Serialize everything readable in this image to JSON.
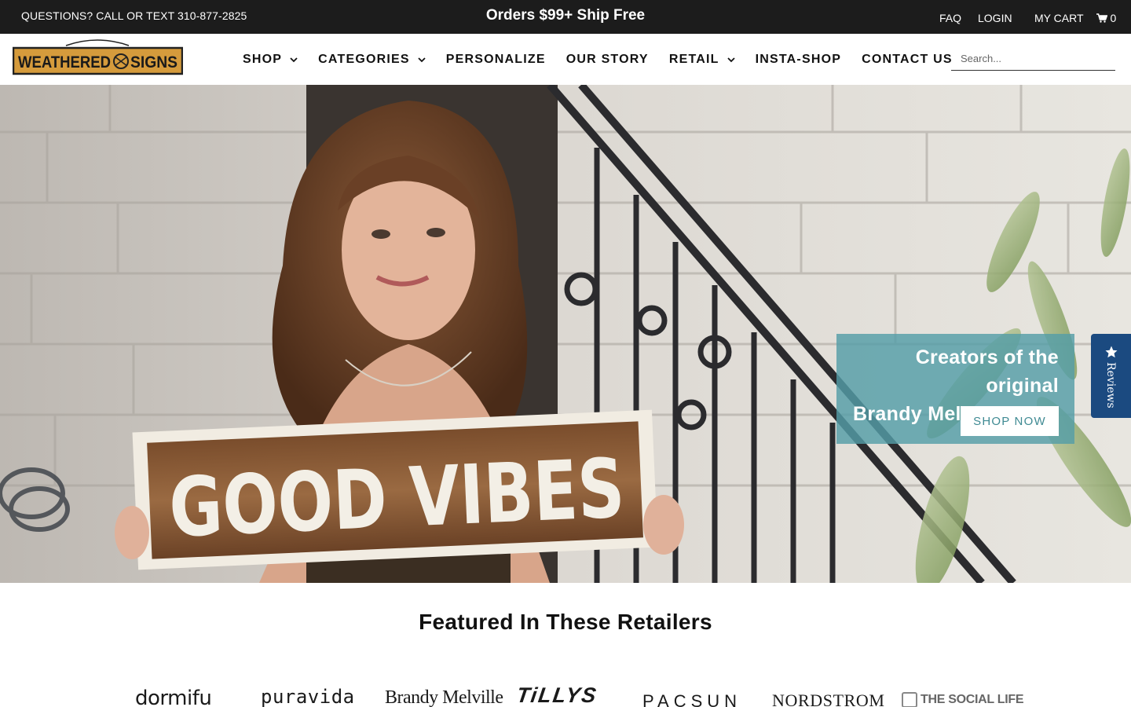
{
  "topbar": {
    "phone_text": "QUESTIONS? CALL OR TEXT 310-877-2825",
    "promo_text": "Orders $99+ Ship Free",
    "faq_label": "FAQ",
    "login_label": "LOGIN",
    "cart_label": "MY CART",
    "cart_count": "0"
  },
  "header": {
    "logo_text_left": "WEATHERED",
    "logo_text_right": "SIGNS",
    "nav": [
      {
        "label": "SHOP",
        "has_dropdown": true
      },
      {
        "label": "CATEGORIES",
        "has_dropdown": true
      },
      {
        "label": "PERSONALIZE",
        "has_dropdown": false
      },
      {
        "label": "OUR STORY",
        "has_dropdown": false
      },
      {
        "label": "RETAIL",
        "has_dropdown": true
      },
      {
        "label": "INSTA-SHOP",
        "has_dropdown": false
      },
      {
        "label": "CONTACT US",
        "has_dropdown": false
      }
    ],
    "search_placeholder": "Search..."
  },
  "hero": {
    "sign_text": "GOOD VIBES",
    "cta_line1": "Creators of the original",
    "cta_line2": "Brandy Melville signs",
    "cta_button": "SHOP NOW"
  },
  "reviews_tab": {
    "label": "Reviews"
  },
  "featured": {
    "title": "Featured In These Retailers",
    "retailers": [
      "dormifu",
      "puravida",
      "Brandy Melville",
      "TiLLYS",
      "PACSUN",
      "NORDSTROM",
      "THE SOCIAL LIFE"
    ]
  },
  "colors": {
    "topbar_bg": "#1c1c1c",
    "cta_teal": "#549ea7",
    "reviews_blue": "#1b4a80",
    "logo_gold": "#d59b3c"
  }
}
